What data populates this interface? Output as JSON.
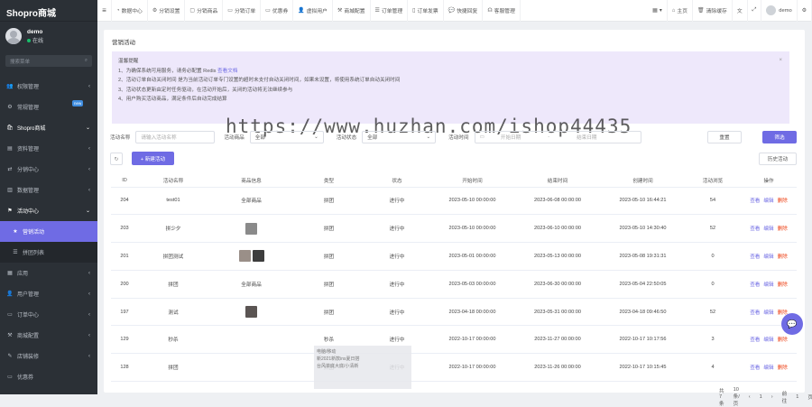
{
  "brand": "Shopro商城",
  "user": {
    "name": "demo",
    "status": "在线"
  },
  "sidebar": {
    "search_placeholder": "搜索菜单",
    "items": [
      {
        "label": "权限管理",
        "icon": "users-icon",
        "arrow": "‹"
      },
      {
        "label": "常规管理",
        "icon": "gear-icon",
        "badge": "new"
      },
      {
        "label": "Shopro商城",
        "icon": "shop-icon",
        "arrow": "⌄"
      },
      {
        "label": "资料管理",
        "icon": "file-icon",
        "arrow": "‹"
      },
      {
        "label": "分销中心",
        "icon": "share-icon",
        "arrow": "‹"
      },
      {
        "label": "数据管理",
        "icon": "chart-icon",
        "arrow": "‹"
      },
      {
        "label": "活动中心",
        "icon": "flag-icon",
        "arrow": "⌄"
      },
      {
        "label": "营销活动",
        "icon": "star-icon"
      },
      {
        "label": "拼团列表",
        "icon": "list-icon"
      },
      {
        "label": "应用",
        "icon": "grid-icon",
        "arrow": "‹"
      },
      {
        "label": "用户管理",
        "icon": "user-icon",
        "arrow": "‹"
      },
      {
        "label": "订单中心",
        "icon": "order-icon",
        "arrow": "‹"
      },
      {
        "label": "商城配置",
        "icon": "setting-icon",
        "arrow": "‹"
      },
      {
        "label": "店铺装修",
        "icon": "brush-icon",
        "arrow": "‹"
      },
      {
        "label": "优惠券",
        "icon": "ticket-icon"
      }
    ]
  },
  "topbar": {
    "items": [
      {
        "label": "数据中心",
        "icon": "dashboard-icon"
      },
      {
        "label": "分销设置",
        "icon": "gear-icon"
      },
      {
        "label": "分销商品",
        "icon": "box-icon"
      },
      {
        "label": "分销订单",
        "icon": "order-icon"
      },
      {
        "label": "优惠券",
        "icon": "ticket-icon"
      },
      {
        "label": "虚拟用户",
        "icon": "user-icon"
      },
      {
        "label": "商城配置",
        "icon": "setting-icon"
      },
      {
        "label": "订单管理",
        "icon": "list-icon"
      },
      {
        "label": "订单发票",
        "icon": "invoice-icon"
      },
      {
        "label": "快捷回复",
        "icon": "chat-icon"
      },
      {
        "label": "客服管理",
        "icon": "headset-icon"
      }
    ],
    "home": "主页",
    "clear_cache": "清除缓存",
    "user": "demo"
  },
  "page": {
    "title": "营销活动",
    "notice": {
      "title": "温馨提醒",
      "line1": "1、为确保系统可用服务，请务必配置 Redis",
      "line1_link": "查看文档",
      "line2": "2、活动订单自动关闭时间 是为当前活动订单专门设置的超时未支付自动关闭时间，如果未设置，将使用系统订单自动关闭时间",
      "line3": "3、活动状态更新由定时任务驱动，在活动开始后，关闭的活动将无法继续参与",
      "line4": "4、用户购买活动商品，满足条件后自动完成结算"
    },
    "watermark": "https://www.huzhan.com/ishop44435",
    "filters": {
      "name_label": "活动名称",
      "name_placeholder": "请输入活动名称",
      "goods_label": "活动商品",
      "goods_value": "全部",
      "status_label": "活动状态",
      "status_value": "全部",
      "time_label": "活动时间",
      "start_placeholder": "开始日期",
      "sep": "-",
      "end_placeholder": "结束日期",
      "reset": "重置",
      "search": "筛选"
    },
    "toolbar": {
      "refresh": "↻",
      "add": "+ 新建活动",
      "recycle": "历史活动"
    },
    "table": {
      "headers": [
        "ID",
        "活动名称",
        "商品信息",
        "类型",
        "状态",
        "开始时间",
        "结束时间",
        "创建时间",
        "活动浏览",
        "操作"
      ],
      "rows": [
        {
          "id": "204",
          "name": "test01",
          "goods": "全部商品",
          "type": "拼团",
          "status": "进行中",
          "start": "2023-05-10 00:00:00",
          "end": "2023-06-08 00:00:00",
          "created": "2023-05-10 16:44:21",
          "views": "54",
          "thumbs": []
        },
        {
          "id": "203",
          "name": "拼少夕",
          "goods": "",
          "type": "拼团",
          "status": "进行中",
          "start": "2023-05-10 00:00:00",
          "end": "2023-06-10 00:00:00",
          "created": "2023-05-10 14:30:40",
          "views": "52",
          "thumbs": [
            "#8a8a8a"
          ]
        },
        {
          "id": "201",
          "name": "拼团测试",
          "goods": "",
          "type": "拼团",
          "status": "进行中",
          "start": "2023-05-01 00:00:00",
          "end": "2023-05-13 00:00:00",
          "created": "2023-05-08 19:31:31",
          "views": "0",
          "thumbs": [
            "#9a8f88",
            "#3d3d3d"
          ]
        },
        {
          "id": "200",
          "name": "拼团",
          "goods": "全部商品",
          "type": "拼团",
          "status": "进行中",
          "start": "2023-05-03 00:00:00",
          "end": "2023-06-30 00:00:00",
          "created": "2023-05-04 22:50:05",
          "views": "0",
          "thumbs": []
        },
        {
          "id": "197",
          "name": "测试",
          "goods": "",
          "type": "拼团",
          "status": "进行中",
          "start": "2023-04-18 00:00:00",
          "end": "2023-05-31 00:00:00",
          "created": "2023-04-18 09:46:50",
          "views": "52",
          "thumbs": [
            "#5b5553"
          ]
        },
        {
          "id": "129",
          "name": "秒杀",
          "goods": "",
          "type": "秒杀",
          "status": "进行中",
          "start": "2022-10-17 00:00:00",
          "end": "2023-11-27 00:00:00",
          "created": "2022-10-17 10:17:56",
          "views": "3",
          "thumbs": []
        },
        {
          "id": "128",
          "name": "拼团",
          "goods": "",
          "type": "拼团",
          "status": "进行中",
          "start": "2022-10-17 00:00:00",
          "end": "2023-11-26 00:00:00",
          "created": "2022-10-17 10:15:45",
          "views": "4",
          "thumbs": []
        }
      ],
      "ops": {
        "view": "查看",
        "edit": "编辑",
        "delete": "删除"
      }
    },
    "overlay": {
      "line1": "电脑/移动",
      "line2": "新2021新款ins夏日搭",
      "line3": "台风单底大底/小清新"
    },
    "pager": {
      "total": "共 7 条",
      "size": "10条/页",
      "prev": "‹",
      "page": "1",
      "next": "›",
      "goto": "前往",
      "goto_page": "1",
      "suffix": "页"
    }
  }
}
